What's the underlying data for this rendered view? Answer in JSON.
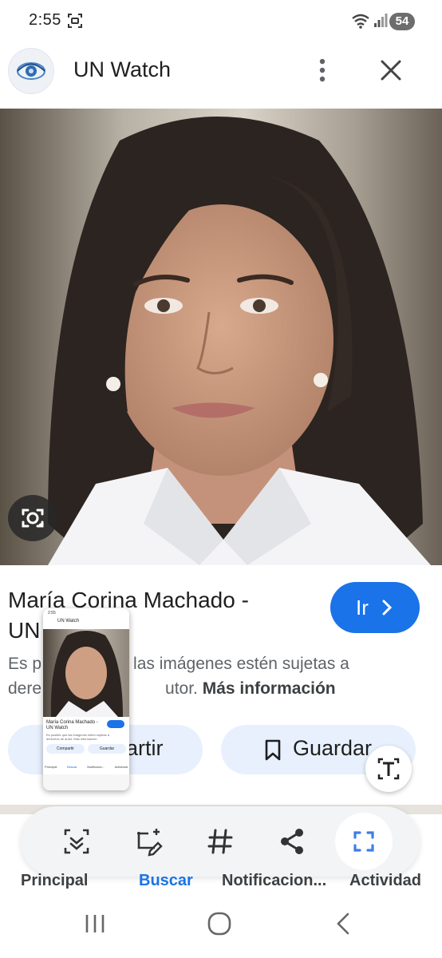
{
  "status_bar": {
    "time": "2:55",
    "battery": "54"
  },
  "header": {
    "title": "UN Watch"
  },
  "result": {
    "title": "María Corina Machado - UN Watch",
    "visible_title_line1": "María Corina Machado -",
    "visible_title_line2": "UN",
    "go_button": "Ir",
    "notice_start": "Es p",
    "notice_middle": "las imágenes estén sujetas a",
    "notice_line2_start": "dere",
    "notice_line2_mid": "utor.",
    "more_info": "Más información",
    "share_button": "artir",
    "save_button": "Guardar"
  },
  "thumbnail": {
    "time": "2:55",
    "title": "UN Watch",
    "result_title": "María Corina Machado - UN Watch",
    "notice": "Es posible que las imágenes estén sujetas a derechos de autor. Más información",
    "share": "Compartir",
    "save": "Guardar",
    "nav": [
      "Principal",
      "Buscar",
      "Notificacio...",
      "Actividad"
    ]
  },
  "bottom_nav": [
    "Principal",
    "Buscar",
    "Notificacion...",
    "Actividad"
  ],
  "colors": {
    "accent": "#1a73e8",
    "pill_bg": "#e8f0fe",
    "toolbar_bg": "#f3f4f6"
  }
}
